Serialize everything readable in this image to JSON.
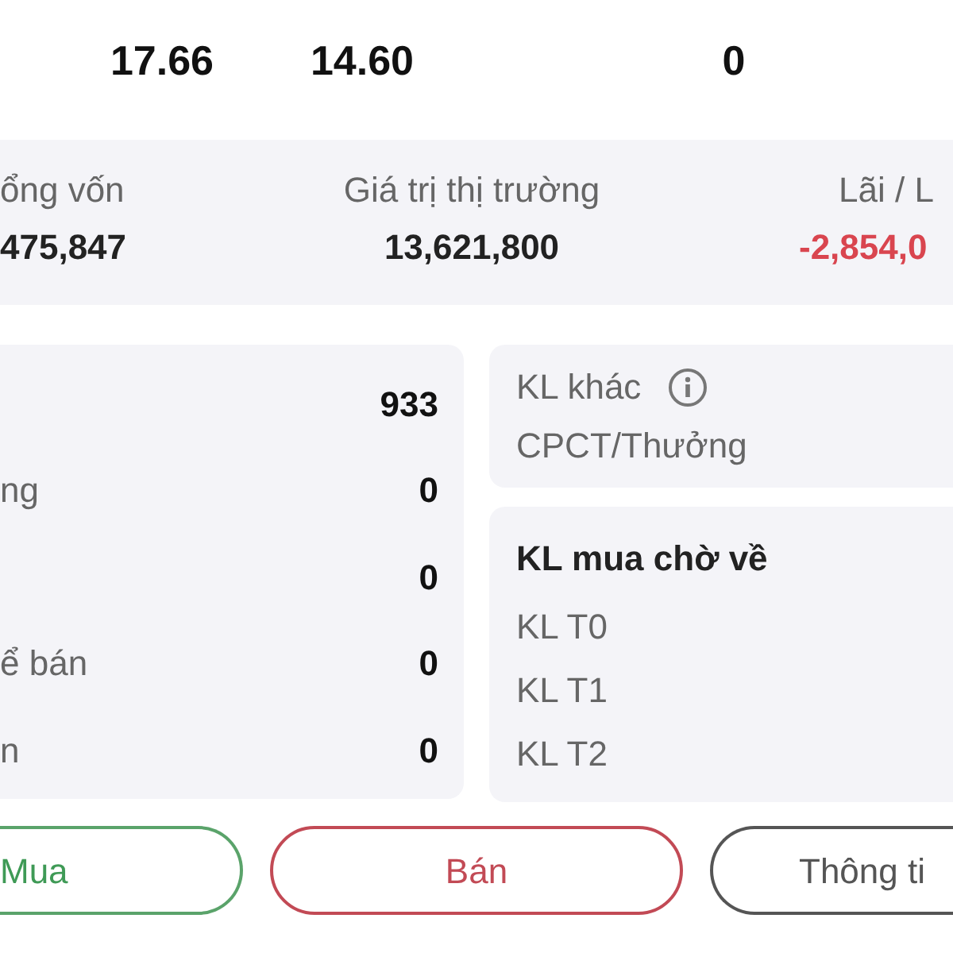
{
  "top_values": [
    "17.66",
    "14.60",
    "0"
  ],
  "summary": [
    {
      "label": "ổng vốn",
      "value": "475,847",
      "kind": "plain"
    },
    {
      "label": "Giá trị thị trường",
      "value": "13,621,800",
      "kind": "plain"
    },
    {
      "label": "Lãi / L",
      "value": "-2,854,0",
      "kind": "loss"
    }
  ],
  "holdings": [
    {
      "value": "933"
    },
    {
      "label": "ng",
      "value": "0"
    },
    {
      "value": "0"
    },
    {
      "label": "ể bán",
      "value": "0"
    },
    {
      "label": "n",
      "value": "0"
    }
  ],
  "other": {
    "title": "KL khác",
    "subtitle": "CPCT/Thưởng"
  },
  "pending": {
    "title": "KL mua chờ về",
    "rows": [
      "KL T0",
      "KL T1",
      "KL T2"
    ]
  },
  "actions": [
    {
      "label": "Mua",
      "kind": "buy"
    },
    {
      "label": "Bán",
      "kind": "sell"
    },
    {
      "label": "Thông ti",
      "kind": "info"
    }
  ]
}
